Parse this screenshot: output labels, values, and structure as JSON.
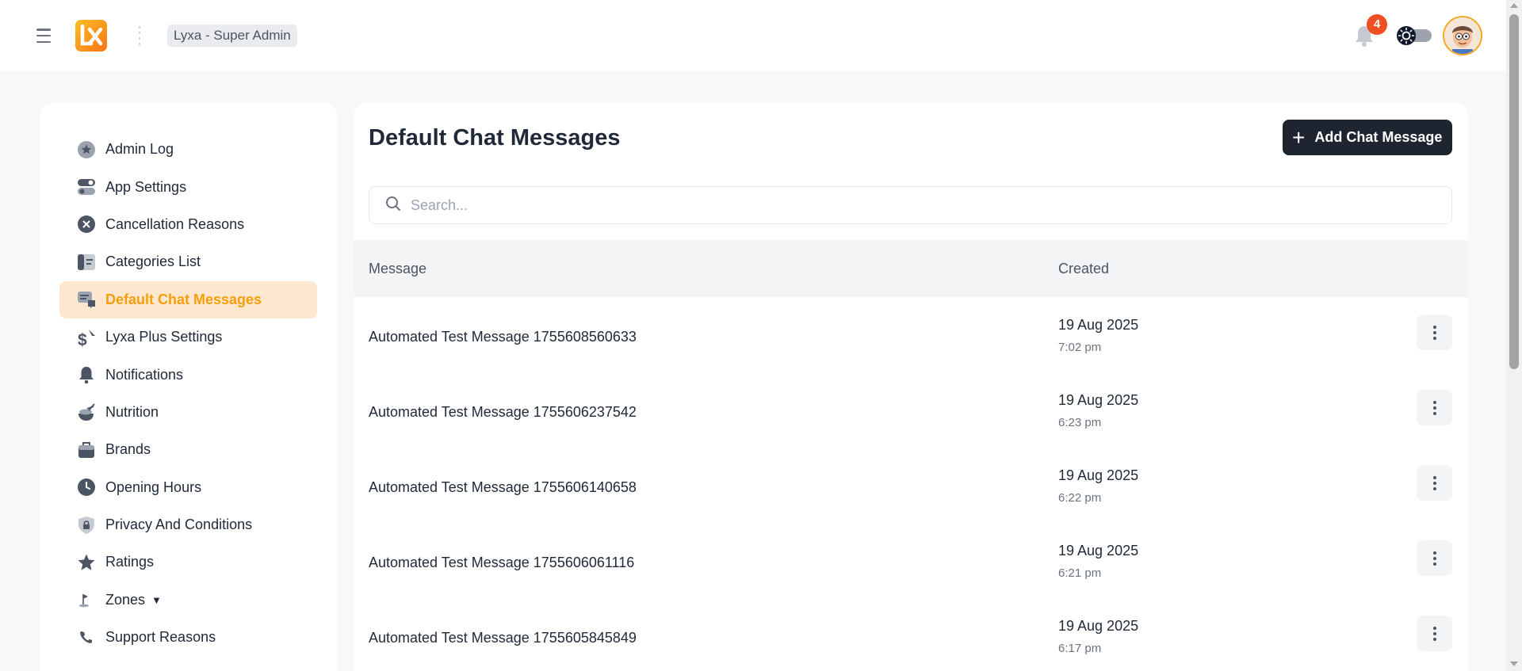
{
  "header": {
    "tenant": "Lyxa - Super Admin",
    "notification_count": "4"
  },
  "sidebar": {
    "items": [
      {
        "label": "Admin Log",
        "icon": "star-badge-icon",
        "active": false
      },
      {
        "label": "App Settings",
        "icon": "toggles-icon",
        "active": false
      },
      {
        "label": "Cancellation Reasons",
        "icon": "x-circle-icon",
        "active": false
      },
      {
        "label": "Categories List",
        "icon": "list-card-icon",
        "active": false
      },
      {
        "label": "Default Chat Messages",
        "icon": "chat-icon",
        "active": true
      },
      {
        "label": "Lyxa Plus Settings",
        "icon": "dollar-icon",
        "active": false
      },
      {
        "label": "Notifications",
        "icon": "bell-icon",
        "active": false
      },
      {
        "label": "Nutrition",
        "icon": "food-icon",
        "active": false
      },
      {
        "label": "Brands",
        "icon": "briefcase-icon",
        "active": false
      },
      {
        "label": "Opening Hours",
        "icon": "clock-icon",
        "active": false
      },
      {
        "label": "Privacy And Conditions",
        "icon": "lock-shield-icon",
        "active": false
      },
      {
        "label": "Ratings",
        "icon": "star-icon",
        "active": false
      },
      {
        "label": "Zones",
        "icon": "flag-icon",
        "active": false,
        "has_caret": true
      },
      {
        "label": "Support Reasons",
        "icon": "phone-icon",
        "active": false
      }
    ]
  },
  "main": {
    "title": "Default Chat Messages",
    "add_button": "Add Chat Message",
    "search_placeholder": "Search...",
    "columns": {
      "message": "Message",
      "created": "Created"
    },
    "rows": [
      {
        "message": "Automated Test Message 1755608560633",
        "date": "19 Aug 2025",
        "time": "7:02 pm"
      },
      {
        "message": "Automated Test Message 1755606237542",
        "date": "19 Aug 2025",
        "time": "6:23 pm"
      },
      {
        "message": "Automated Test Message 1755606140658",
        "date": "19 Aug 2025",
        "time": "6:22 pm"
      },
      {
        "message": "Automated Test Message 1755606061116",
        "date": "19 Aug 2025",
        "time": "6:21 pm"
      },
      {
        "message": "Automated Test Message 1755605845849",
        "date": "19 Aug 2025",
        "time": "6:17 pm"
      }
    ]
  },
  "colors": {
    "accent": "#f59e0b",
    "active_bg": "#fde8cf",
    "dark_button": "#1f2530",
    "badge": "#f04e23"
  }
}
